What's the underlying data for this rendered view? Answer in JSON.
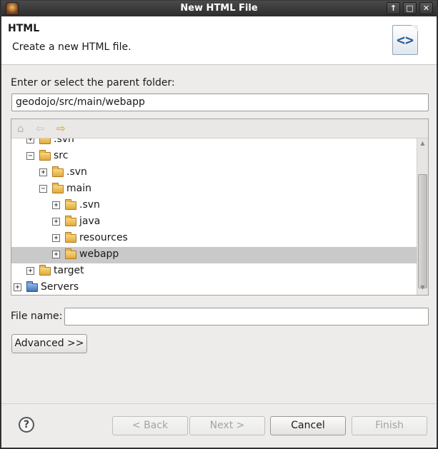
{
  "window": {
    "title": "New HTML File",
    "controls": [
      "↑",
      "□",
      "✕"
    ]
  },
  "banner": {
    "title": "HTML",
    "description": "Create a new HTML file.",
    "icon": "html-file-icon"
  },
  "parent_folder": {
    "label": "Enter or select the parent folder:",
    "value": "geodojo/src/main/webapp"
  },
  "tree_nav": {
    "home": "⌂",
    "back": "⇦",
    "forward": "⇨"
  },
  "tree": [
    {
      "label": ".svn",
      "level": 1,
      "expanded": false
    },
    {
      "label": "src",
      "level": 1,
      "expanded": true
    },
    {
      "label": ".svn",
      "level": 2,
      "expanded": false
    },
    {
      "label": "main",
      "level": 2,
      "expanded": true
    },
    {
      "label": ".svn",
      "level": 3,
      "expanded": false
    },
    {
      "label": "java",
      "level": 3,
      "expanded": false
    },
    {
      "label": "resources",
      "level": 3,
      "expanded": false
    },
    {
      "label": "webapp",
      "level": 3,
      "expanded": false,
      "selected": true
    },
    {
      "label": "target",
      "level": 1,
      "expanded": false
    },
    {
      "label": "Servers",
      "level": 0,
      "expanded": false,
      "project": true
    }
  ],
  "file_name": {
    "label": "File name:",
    "value": "",
    "placeholder": ""
  },
  "buttons": {
    "advanced": "Advanced >>",
    "help": "?",
    "back": "< Back",
    "next": "Next >",
    "cancel": "Cancel",
    "finish": "Finish"
  }
}
